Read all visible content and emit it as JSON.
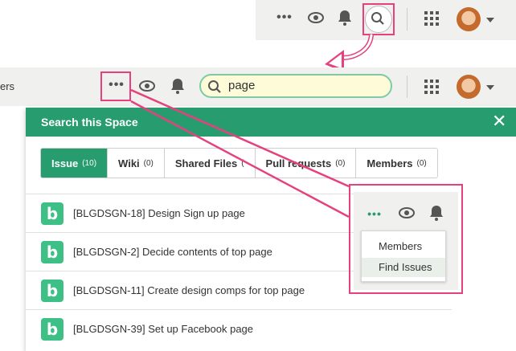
{
  "toolbar_before": {
    "more_icon": "more-horizontal-icon",
    "watch_icon": "eye-icon",
    "notify_icon": "bell-icon",
    "search_icon": "magnifier-icon",
    "apps_icon": "grid-icon",
    "avatar": "user-avatar"
  },
  "toolbar_after": {
    "left_truncated_text": "ers",
    "search_value": "page"
  },
  "panel": {
    "title": "Search this Space",
    "close_glyph": "✕",
    "tabs": [
      {
        "label": "Issue",
        "count": "(10)",
        "active": true
      },
      {
        "label": "Wiki",
        "count": "(0)",
        "active": false
      },
      {
        "label": "Shared Files",
        "count": "(",
        "active": false
      },
      {
        "label": "Pull requests",
        "count": "(0)",
        "active": false
      },
      {
        "label": "Members",
        "count": "(0)",
        "active": false
      }
    ],
    "results": [
      "[BLGDSGN-18] Design Sign up page",
      "[BLGDSGN-2] Decide contents of top page",
      "[BLGDSGN-11] Create design comps for top page",
      "[BLGDSGN-39] Set up Facebook page"
    ],
    "badge_letter": "b"
  },
  "callout": {
    "menu_items": [
      "Members",
      "Find Issues"
    ],
    "selected_index": 1
  },
  "colors": {
    "accent_green": "#279d6f",
    "highlight_pink": "#e4417e",
    "search_bg": "#fdfbd8"
  }
}
